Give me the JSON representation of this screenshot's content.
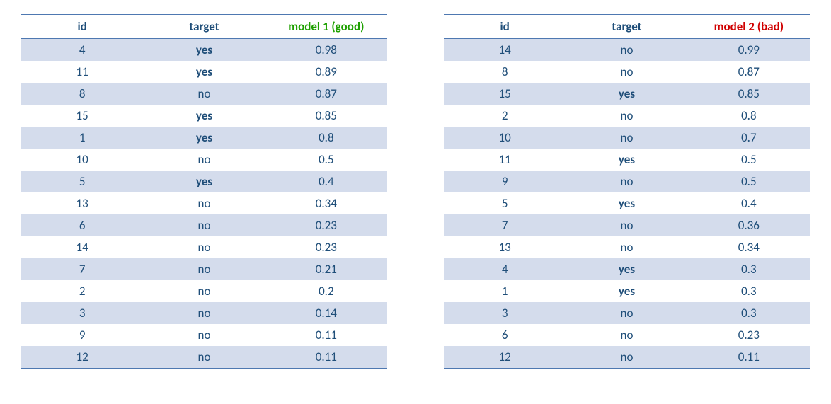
{
  "tables": [
    {
      "headers": {
        "id": "id",
        "target": "target",
        "model": "model 1 (good)"
      },
      "model_class": "model-good",
      "rows": [
        {
          "id": "4",
          "target": "yes",
          "score": "0.98"
        },
        {
          "id": "11",
          "target": "yes",
          "score": "0.89"
        },
        {
          "id": "8",
          "target": "no",
          "score": "0.87"
        },
        {
          "id": "15",
          "target": "yes",
          "score": "0.85"
        },
        {
          "id": "1",
          "target": "yes",
          "score": "0.8"
        },
        {
          "id": "10",
          "target": "no",
          "score": "0.5"
        },
        {
          "id": "5",
          "target": "yes",
          "score": "0.4"
        },
        {
          "id": "13",
          "target": "no",
          "score": "0.34"
        },
        {
          "id": "6",
          "target": "no",
          "score": "0.23"
        },
        {
          "id": "14",
          "target": "no",
          "score": "0.23"
        },
        {
          "id": "7",
          "target": "no",
          "score": "0.21"
        },
        {
          "id": "2",
          "target": "no",
          "score": "0.2"
        },
        {
          "id": "3",
          "target": "no",
          "score": "0.14"
        },
        {
          "id": "9",
          "target": "no",
          "score": "0.11"
        },
        {
          "id": "12",
          "target": "no",
          "score": "0.11"
        }
      ]
    },
    {
      "headers": {
        "id": "id",
        "target": "target",
        "model": "model 2 (bad)"
      },
      "model_class": "model-bad",
      "rows": [
        {
          "id": "14",
          "target": "no",
          "score": "0.99"
        },
        {
          "id": "8",
          "target": "no",
          "score": "0.87"
        },
        {
          "id": "15",
          "target": "yes",
          "score": "0.85"
        },
        {
          "id": "2",
          "target": "no",
          "score": "0.8"
        },
        {
          "id": "10",
          "target": "no",
          "score": "0.7"
        },
        {
          "id": "11",
          "target": "yes",
          "score": "0.5"
        },
        {
          "id": "9",
          "target": "no",
          "score": "0.5"
        },
        {
          "id": "5",
          "target": "yes",
          "score": "0.4"
        },
        {
          "id": "7",
          "target": "no",
          "score": "0.36"
        },
        {
          "id": "13",
          "target": "no",
          "score": "0.34"
        },
        {
          "id": "4",
          "target": "yes",
          "score": "0.3"
        },
        {
          "id": "1",
          "target": "yes",
          "score": "0.3"
        },
        {
          "id": "3",
          "target": "no",
          "score": "0.3"
        },
        {
          "id": "6",
          "target": "no",
          "score": "0.23"
        },
        {
          "id": "12",
          "target": "no",
          "score": "0.11"
        }
      ]
    }
  ]
}
